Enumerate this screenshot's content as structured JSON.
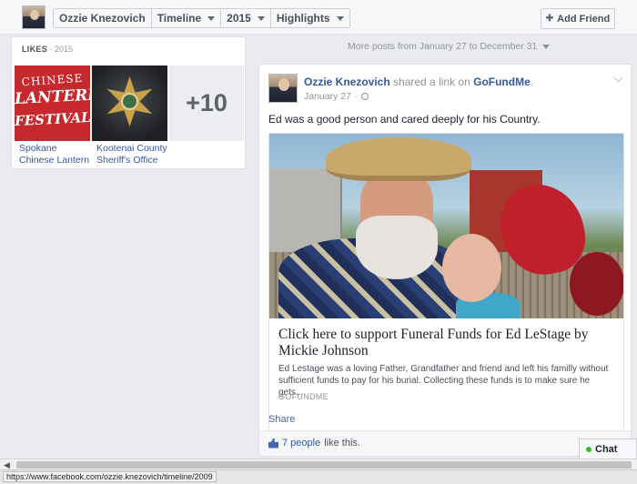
{
  "topbar": {
    "profile_name": "Ozzie Knezovich",
    "timeline_label": "Timeline",
    "year_label": "2015",
    "highlights_label": "Highlights",
    "add_friend_label": "Add Friend"
  },
  "likes": {
    "heading": "LIKES",
    "year": "· 2015",
    "tiles": [
      {
        "label": "Spokane Chinese Lantern",
        "logo_text": [
          "CHINESE",
          "LANTERN",
          "FESTIVAL"
        ]
      },
      {
        "label": "Kootenai County Sheriff's Office"
      }
    ],
    "more_count": "+10"
  },
  "timeline": {
    "more_posts": "More posts from January 27 to December 31"
  },
  "post": {
    "author": "Ozzie Knezovich",
    "verb": "shared a link on",
    "site": "GoFundMe",
    "date": "January 27 ·",
    "text": "Ed was a good person and cared deeply for his Country.",
    "link": {
      "title": "Click here to support Funeral Funds for Ed LeStage by Mickie Johnson",
      "description": "Ed Lestage was a loving Father, Grandfather and friend and left his familly without sufficient funds to pay for his burial. Collecting these funds is to make sure he gets...",
      "source": "GOFUNDME"
    },
    "share_label": "Share",
    "likes_count": "7 people",
    "likes_suffix": "like this."
  },
  "chat": {
    "label": "Chat"
  },
  "status_bar": {
    "url": "https://www.facebook.com/ozzie.knezovich/timeline/2009"
  }
}
